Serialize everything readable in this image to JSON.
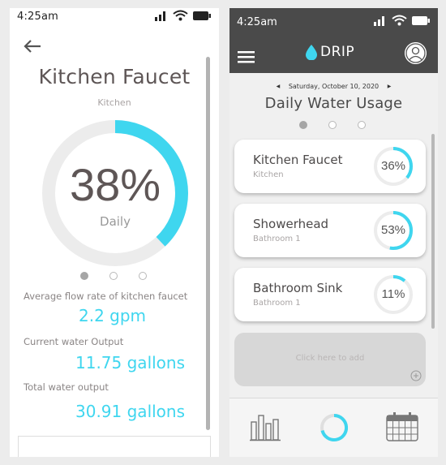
{
  "left": {
    "status_time": "4:25am",
    "title": "Kitchen Faucet",
    "location": "Kitchen",
    "gauge_percent": 38,
    "gauge_text": "38%",
    "gauge_label": "Daily",
    "stats": [
      {
        "label": "Average flow rate of kitchen faucet",
        "value": "2.2 gpm"
      },
      {
        "label": "Current water Output",
        "value": "11.75 gallons"
      },
      {
        "label": "Total water output",
        "value": "30.91 gallons"
      }
    ]
  },
  "right": {
    "status_time": "4:25am",
    "brand": "DRIP",
    "date": "Saturday, October 10, 2020",
    "title": "Daily Water Usage",
    "devices": [
      {
        "name": "Kitchen Faucet",
        "location": "Kitchen",
        "percent": 36,
        "percent_text": "36%"
      },
      {
        "name": "Showerhead",
        "location": "Bathroom 1",
        "percent": 53,
        "percent_text": "53%"
      },
      {
        "name": "Bathroom Sink",
        "location": "Bathroom 1",
        "percent": 11,
        "percent_text": "11%"
      }
    ],
    "add_label": "Click here to add"
  },
  "colors": {
    "accent": "#3fd6ef",
    "header": "#4a4a4a"
  },
  "icons": [
    "back-arrow-icon",
    "signal-icon",
    "wifi-icon",
    "battery-icon",
    "menu-icon",
    "water-drop-icon",
    "user-icon",
    "chevron-left-icon",
    "chevron-right-icon",
    "plus-icon",
    "bar-chart-icon",
    "usage-ring-icon",
    "calendar-icon"
  ]
}
